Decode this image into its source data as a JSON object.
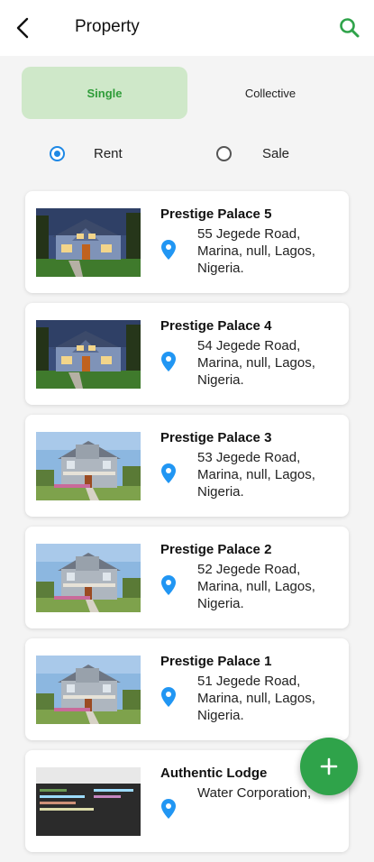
{
  "header": {
    "title": "Property"
  },
  "tabs": [
    {
      "label": "Single",
      "active": true
    },
    {
      "label": "Collective",
      "active": false
    }
  ],
  "filters": [
    {
      "label": "Rent",
      "selected": true
    },
    {
      "label": "Sale",
      "selected": false
    }
  ],
  "properties": [
    {
      "name": "Prestige Palace 5",
      "address": "55 Jegede Road, Marina, null, Lagos, Nigeria.",
      "photo": "blue-house-photo"
    },
    {
      "name": "Prestige Palace 4",
      "address": "54 Jegede Road, Marina, null, Lagos, Nigeria.",
      "photo": "blue-house-photo"
    },
    {
      "name": "Prestige Palace 3",
      "address": "53 Jegede Road, Marina, null, Lagos, Nigeria.",
      "photo": "grey-house-photo"
    },
    {
      "name": "Prestige Palace 2",
      "address": "52 Jegede Road, Marina, null, Lagos, Nigeria.",
      "photo": "grey-house-photo"
    },
    {
      "name": "Prestige Palace 1",
      "address": "51 Jegede Road, Marina, null, Lagos, Nigeria.",
      "photo": "grey-house-photo"
    },
    {
      "name": "Authentic Lodge",
      "address": "Water Corporation,",
      "photo": "code-screenshot-photo"
    }
  ],
  "icons": {
    "back": "arrow-left-icon",
    "search": "search-icon",
    "location": "location-pin-icon",
    "add": "plus-icon"
  },
  "colors": {
    "accent_green": "#2fa34a",
    "tab_active_bg": "#cfe8c9",
    "tab_active_text": "#2e9c38",
    "radio_blue": "#1e88e5",
    "pin_blue": "#2196f3"
  }
}
